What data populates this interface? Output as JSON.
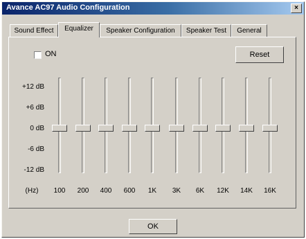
{
  "window": {
    "title": "Avance AC97 Audio Configuration",
    "close_symbol": "×"
  },
  "tabs": [
    {
      "label": "Sound Effect"
    },
    {
      "label": "Equalizer",
      "active": true
    },
    {
      "label": "Speaker Configuration"
    },
    {
      "label": "Speaker Test"
    },
    {
      "label": "General"
    }
  ],
  "equalizer": {
    "on_label": "ON",
    "on_checked": false,
    "reset_label": "Reset",
    "db_labels": [
      "+12 dB",
      "+6 dB",
      "0 dB",
      "-6 dB",
      "-12 dB"
    ],
    "hz_label": "(Hz)",
    "db_range": [
      -12,
      12
    ],
    "bands": [
      {
        "label": "100",
        "gain_db": 0
      },
      {
        "label": "200",
        "gain_db": 0
      },
      {
        "label": "400",
        "gain_db": 0
      },
      {
        "label": "600",
        "gain_db": 0
      },
      {
        "label": "1K",
        "gain_db": 0
      },
      {
        "label": "3K",
        "gain_db": 0
      },
      {
        "label": "6K",
        "gain_db": 0
      },
      {
        "label": "12K",
        "gain_db": 0
      },
      {
        "label": "14K",
        "gain_db": 0
      },
      {
        "label": "16K",
        "gain_db": 0
      }
    ]
  },
  "ok_label": "OK"
}
